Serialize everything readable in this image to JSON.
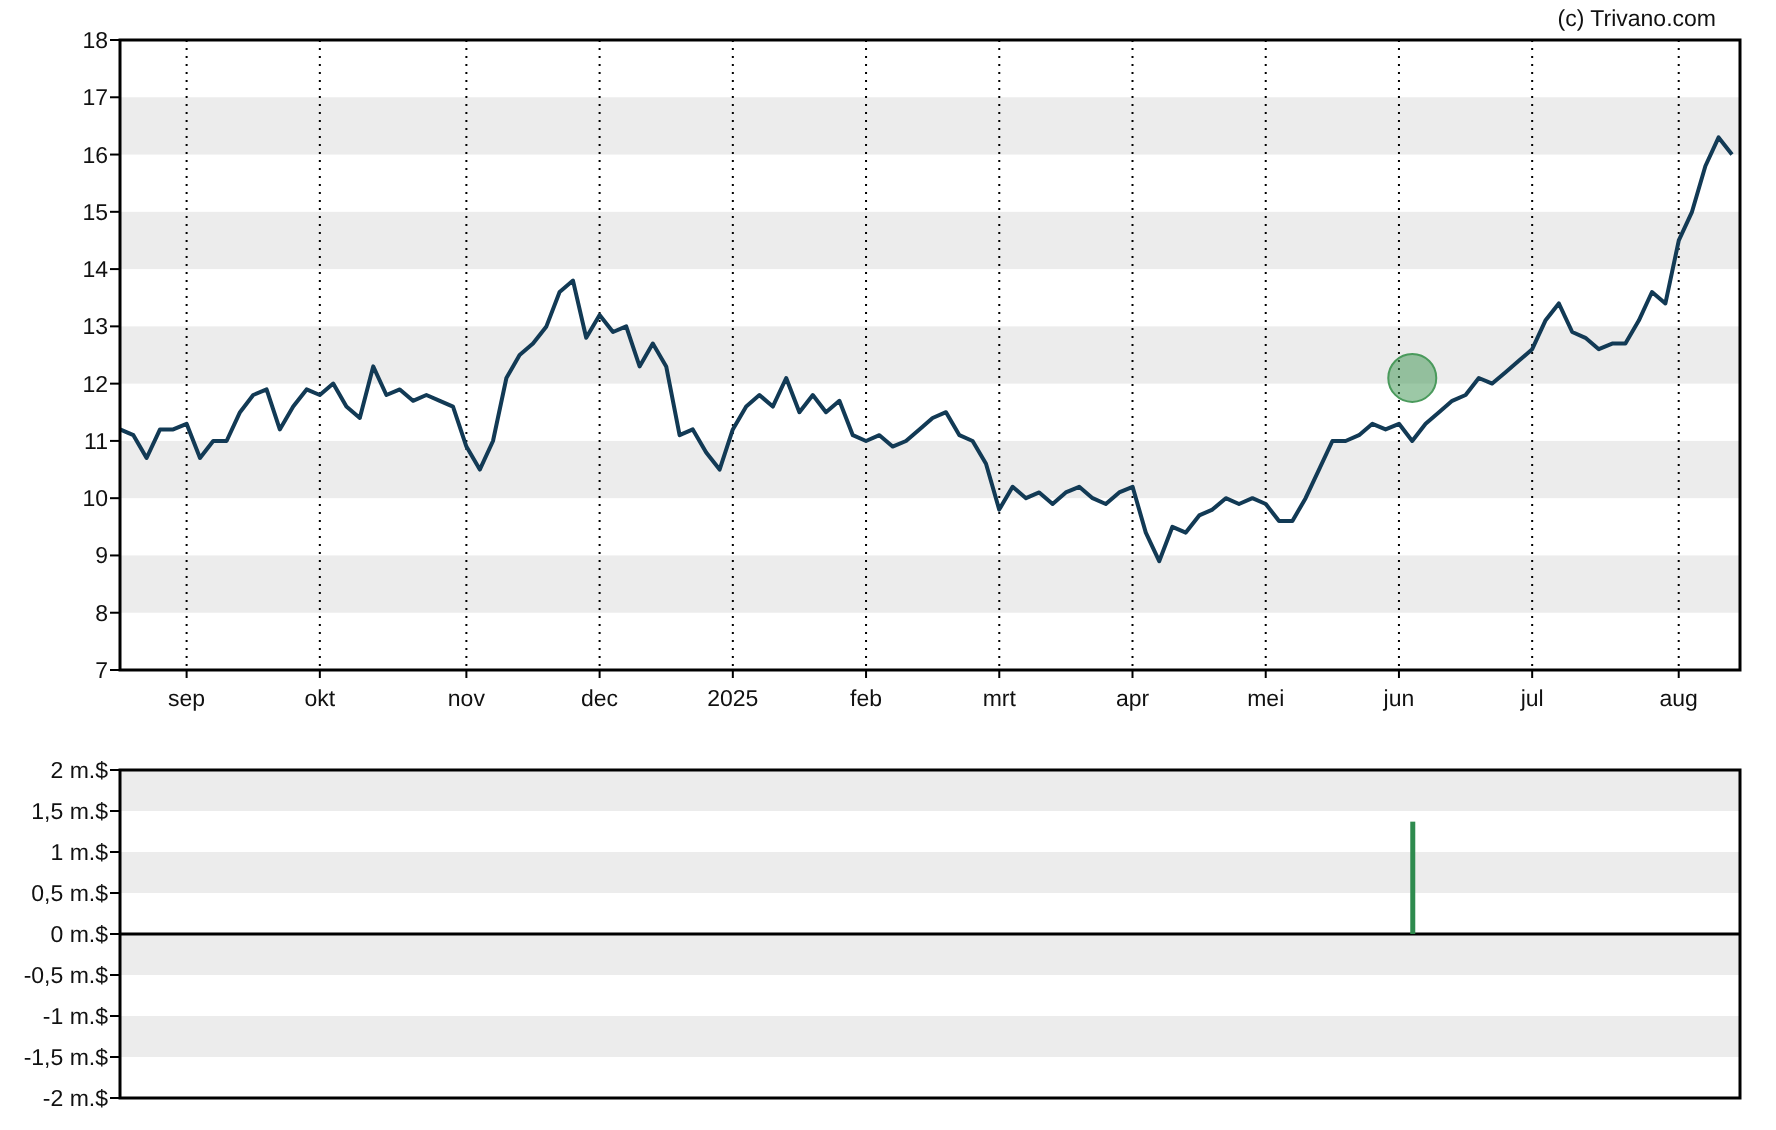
{
  "copyright": "(c) Trivano.com",
  "price_chart": {
    "chart_data": {
      "type": "line",
      "grid": true,
      "ylim": [
        7,
        18
      ],
      "yticks": [
        7,
        8,
        9,
        10,
        11,
        12,
        13,
        14,
        15,
        16,
        17,
        18
      ],
      "categories": [
        null,
        null,
        null,
        null,
        null,
        "sep",
        null,
        null,
        null,
        null,
        null,
        null,
        null,
        null,
        null,
        "okt",
        null,
        null,
        null,
        null,
        null,
        null,
        null,
        null,
        null,
        null,
        "nov",
        null,
        null,
        null,
        null,
        null,
        null,
        null,
        null,
        null,
        "dec",
        null,
        null,
        null,
        null,
        null,
        null,
        null,
        null,
        null,
        "2025",
        null,
        null,
        null,
        null,
        null,
        null,
        null,
        null,
        null,
        "feb",
        null,
        null,
        null,
        null,
        null,
        null,
        null,
        null,
        null,
        "mrt",
        null,
        null,
        null,
        null,
        null,
        null,
        null,
        null,
        null,
        "apr",
        null,
        null,
        null,
        null,
        null,
        null,
        null,
        null,
        null,
        "mei",
        null,
        null,
        null,
        null,
        null,
        null,
        null,
        null,
        null,
        "jun",
        null,
        null,
        null,
        null,
        null,
        null,
        null,
        null,
        null,
        "jul",
        null,
        null,
        null,
        null,
        null,
        null,
        null,
        null,
        null,
        null,
        "aug",
        null,
        null,
        null,
        null
      ],
      "series": [
        {
          "color": "#123a55",
          "values": [
            11.2,
            11.1,
            10.7,
            11.2,
            11.2,
            11.3,
            10.7,
            11.0,
            11.0,
            11.5,
            11.8,
            11.9,
            11.2,
            11.6,
            11.9,
            11.8,
            12.0,
            11.6,
            11.4,
            12.3,
            11.8,
            11.9,
            11.7,
            11.8,
            11.7,
            11.6,
            10.9,
            10.5,
            11.0,
            12.1,
            12.5,
            12.7,
            13.0,
            13.6,
            13.8,
            12.8,
            13.2,
            12.9,
            13.0,
            12.3,
            12.7,
            12.3,
            11.1,
            11.2,
            10.8,
            10.5,
            11.2,
            11.6,
            11.8,
            11.6,
            12.1,
            11.5,
            11.8,
            11.5,
            11.7,
            11.1,
            11.0,
            11.1,
            10.9,
            11.0,
            11.2,
            11.4,
            11.5,
            11.1,
            11.0,
            10.6,
            9.8,
            10.2,
            10.0,
            10.1,
            9.9,
            10.1,
            10.2,
            10.0,
            9.9,
            10.1,
            10.2,
            9.4,
            8.9,
            9.5,
            9.4,
            9.7,
            9.8,
            10.0,
            9.9,
            10.0,
            9.9,
            9.6,
            9.6,
            10.0,
            10.5,
            11.0,
            11.0,
            11.1,
            11.3,
            11.2,
            11.3,
            11.0,
            11.3,
            11.5,
            11.7,
            11.8,
            12.1,
            12.0,
            12.2,
            12.4,
            12.6,
            13.1,
            13.4,
            12.9,
            12.8,
            12.6,
            12.7,
            12.7,
            13.1,
            13.6,
            13.4,
            14.5,
            15.0,
            15.8,
            16.3,
            16.0
          ]
        }
      ]
    }
  },
  "volume_chart": {
    "chart_data": {
      "type": "bar",
      "ylim": [
        -2,
        2
      ],
      "yticks": [
        {
          "value": 2,
          "label": "2 m.$"
        },
        {
          "value": 1.5,
          "label": "1,5 m.$"
        },
        {
          "value": 1,
          "label": "1 m.$"
        },
        {
          "value": 0.5,
          "label": "0,5 m.$"
        },
        {
          "value": 0,
          "label": "0 m.$"
        },
        {
          "value": -0.5,
          "label": "-0,5 m.$"
        },
        {
          "value": -1,
          "label": "-1 m.$"
        },
        {
          "value": -1.5,
          "label": "-1,5 m.$"
        },
        {
          "value": -2,
          "label": "-2 m.$"
        }
      ],
      "categories": [
        null,
        null,
        null,
        null,
        null,
        null,
        null,
        null,
        null,
        null,
        null,
        null,
        null,
        null,
        null,
        null,
        null,
        null,
        null,
        null,
        null,
        null,
        null,
        null,
        null,
        null,
        null,
        null,
        null,
        null,
        null,
        null,
        null,
        null,
        null,
        null,
        null,
        null,
        null,
        null,
        null,
        null,
        null,
        null,
        null,
        null,
        null,
        null,
        null,
        null,
        null,
        null,
        null,
        null,
        null,
        null,
        null,
        null,
        null,
        null,
        null,
        null,
        null,
        null,
        null,
        null,
        null,
        null,
        null,
        null,
        null,
        null,
        null,
        null,
        null,
        null,
        null,
        null,
        null,
        null,
        null,
        null,
        null,
        null,
        null,
        null,
        null,
        null,
        null,
        null,
        null,
        null,
        null,
        null,
        null,
        null,
        null,
        null,
        null,
        null,
        null,
        null,
        null,
        null,
        null,
        null,
        null,
        null,
        null,
        null,
        null,
        null,
        null,
        null,
        null,
        null,
        null,
        null,
        null,
        null,
        null,
        null
      ],
      "series": [
        {
          "color": "#2e8b4e",
          "values": [
            null,
            null,
            null,
            null,
            null,
            null,
            null,
            null,
            null,
            null,
            null,
            null,
            null,
            null,
            null,
            null,
            null,
            null,
            null,
            null,
            null,
            null,
            null,
            null,
            null,
            null,
            null,
            null,
            null,
            null,
            null,
            null,
            null,
            null,
            null,
            null,
            null,
            null,
            null,
            null,
            null,
            null,
            null,
            null,
            null,
            null,
            null,
            null,
            null,
            null,
            null,
            null,
            null,
            null,
            null,
            null,
            null,
            null,
            null,
            null,
            null,
            null,
            null,
            null,
            null,
            null,
            null,
            null,
            null,
            null,
            null,
            null,
            null,
            null,
            null,
            null,
            null,
            null,
            null,
            null,
            null,
            null,
            null,
            null,
            null,
            null,
            null,
            null,
            null,
            null,
            null,
            null,
            null,
            null,
            null,
            null,
            null,
            1.37,
            null,
            null,
            null,
            null,
            null,
            null,
            null,
            null,
            null,
            null,
            null,
            null,
            null,
            null,
            null,
            null,
            null,
            null,
            null,
            null,
            null,
            null,
            null,
            null
          ]
        }
      ]
    }
  }
}
